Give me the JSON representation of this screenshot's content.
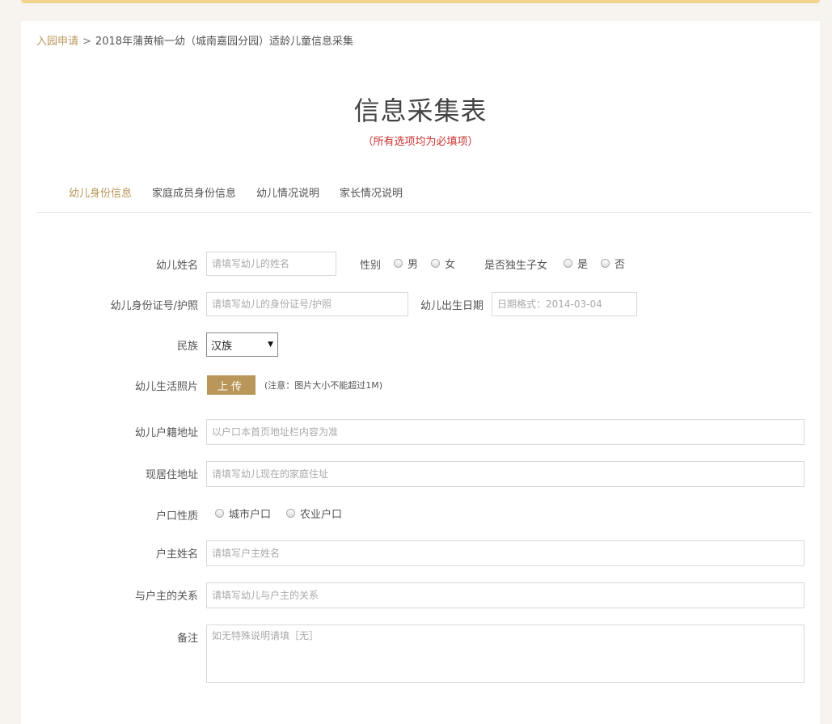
{
  "breadcrumb": {
    "link": "入园申请",
    "separator": ">",
    "current": "2018年蒲黄榆一幼（城南嘉园分园）适龄儿童信息采集"
  },
  "title": "信息采集表",
  "subtitle": {
    "open": "（",
    "text": "所有选项均为必填项",
    "close": "）"
  },
  "tabs": [
    {
      "label": "幼儿身份信息",
      "active": true
    },
    {
      "label": "家庭成员身份信息",
      "active": false
    },
    {
      "label": "幼儿情况说明",
      "active": false
    },
    {
      "label": "家长情况说明",
      "active": false
    }
  ],
  "form": {
    "child_name": {
      "label": "幼儿姓名",
      "placeholder": "请填写幼儿的姓名"
    },
    "gender": {
      "label": "性别",
      "options": [
        "男",
        "女"
      ]
    },
    "only_child": {
      "label": "是否独生子女",
      "options": [
        "是",
        "否"
      ]
    },
    "id_number": {
      "label": "幼儿身份证号/护照",
      "placeholder": "请填写幼儿的身份证号/护照"
    },
    "birth_date": {
      "label": "幼儿出生日期",
      "placeholder": "日期格式：2014-03-04"
    },
    "ethnicity": {
      "label": "民族",
      "value": "汉族"
    },
    "photo": {
      "label": "幼儿生活照片",
      "button": "上传",
      "note": "(注意：图片大小不能超过1M)"
    },
    "household_address": {
      "label": "幼儿户籍地址",
      "placeholder": "以户口本首页地址栏内容为准"
    },
    "current_address": {
      "label": "现居住地址",
      "placeholder": "请填写幼儿现在的家庭住址"
    },
    "household_type": {
      "label": "户口性质",
      "options": [
        "城市户口",
        "农业户口"
      ]
    },
    "householder_name": {
      "label": "户主姓名",
      "placeholder": "请填写户主姓名"
    },
    "relation": {
      "label": "与户主的关系",
      "placeholder": "请填写幼儿与户主的关系"
    },
    "remark": {
      "label": "备注",
      "placeholder": "如无特殊说明请填［无］"
    }
  },
  "colors": {
    "accent": "#b9965a",
    "required": "#cc3333",
    "strip": "#f3d48e"
  }
}
